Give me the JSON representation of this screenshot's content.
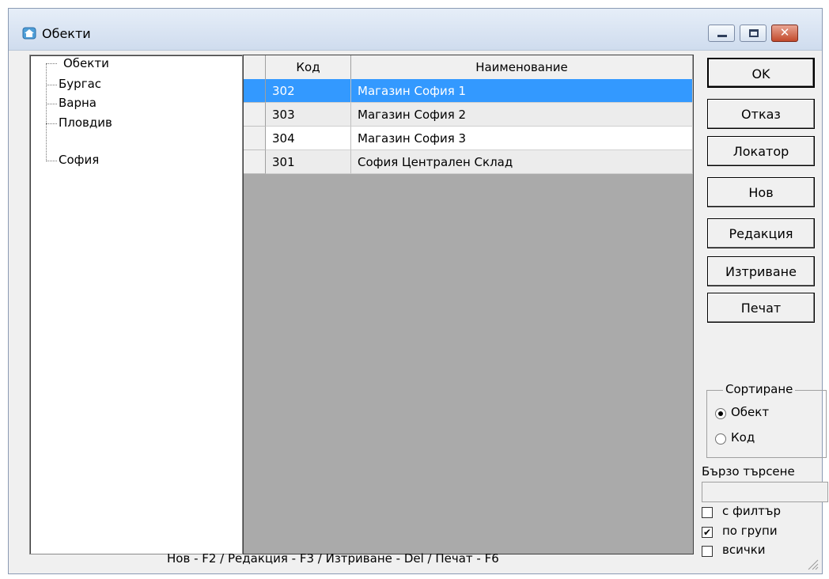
{
  "window": {
    "title": "Обекти"
  },
  "tree": {
    "items": [
      {
        "label": "Обекти"
      },
      {
        "label": "Бургас"
      },
      {
        "label": "Варна"
      },
      {
        "label": "Пловдив"
      },
      {
        "label": "София"
      }
    ]
  },
  "grid": {
    "columns": [
      {
        "label": "Код"
      },
      {
        "label": "Наименование"
      }
    ],
    "rows": [
      {
        "code": "302",
        "name": "Магазин София 1",
        "selected": true
      },
      {
        "code": "303",
        "name": "Магазин София 2"
      },
      {
        "code": "304",
        "name": "Магазин София 3"
      },
      {
        "code": "301",
        "name": "София Централен Склад"
      }
    ]
  },
  "buttons": {
    "ok": "OK",
    "cancel": "Отказ",
    "locator": "Локатор",
    "new": "Нов",
    "edit": "Редакция",
    "delete": "Изтриване",
    "print": "Печат"
  },
  "sorting": {
    "title": "Сортиране",
    "options": [
      "Обект",
      "Код"
    ],
    "selected": "Обект"
  },
  "quick_search": {
    "label": "Бързо търсене",
    "value": ""
  },
  "filters": {
    "with_filter": {
      "label": "с филтър",
      "checked": false
    },
    "by_groups": {
      "label": "по групи",
      "checked": true
    },
    "all": {
      "label": "всички",
      "checked": false
    }
  },
  "statusbar": {
    "hint": "Нов - F2 / Редакция - F3 / Изтриване - Del / Печат - F6"
  },
  "colors": {
    "selection": "#3399ff",
    "grid_background": "#aaaaaa",
    "alt_row": "#ececec"
  }
}
